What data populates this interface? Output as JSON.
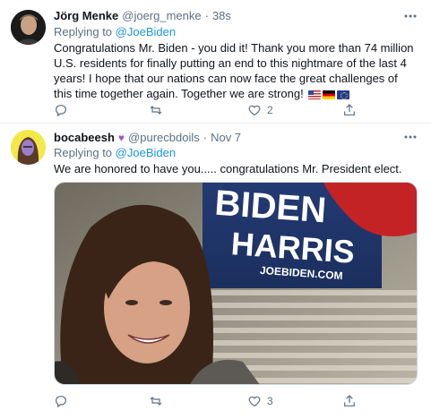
{
  "tweets": [
    {
      "display_name": "Jörg Menke",
      "handle": "@joerg_menke",
      "separator": "·",
      "timestamp": "38s",
      "replying_to_label": "Replying to",
      "replying_to_handle": "@JoeBiden",
      "text": "Congratulations Mr. Biden - you did it! Thank you more than 74 million U.S. residents for finally putting an end to this nightmare of the last 4 years! I hope that our nations can now face the great challenges of this time together again. Together we are strong!",
      "flags": [
        "us-flag",
        "germany-flag",
        "eu-flag"
      ],
      "reply_count": "",
      "retweet_count": "",
      "like_count": "2"
    },
    {
      "display_name": "bocabeesh",
      "name_emoji": "♥",
      "handle": "@purecbdoils",
      "separator": "·",
      "timestamp": "Nov 7",
      "replying_to_label": "Replying to",
      "replying_to_handle": "@JoeBiden",
      "text": "We are honored to have you..... congratulations Mr. President elect.",
      "media": {
        "sign_line_1": "BIDEN",
        "sign_line_2": "HARRIS",
        "sign_url": "JOEBIDEN.COM"
      },
      "reply_count": "",
      "retweet_count": "",
      "like_count": "3"
    }
  ],
  "colors": {
    "text_primary": "#0f1419",
    "text_secondary": "#5b7083",
    "link": "#1b95e0",
    "divider": "#e6ecf0",
    "heart_emoji": "#9b59d0"
  },
  "icons": {
    "more": "more-horizontal-icon",
    "reply": "reply-icon",
    "retweet": "retweet-icon",
    "like": "heart-icon",
    "share": "share-icon"
  }
}
